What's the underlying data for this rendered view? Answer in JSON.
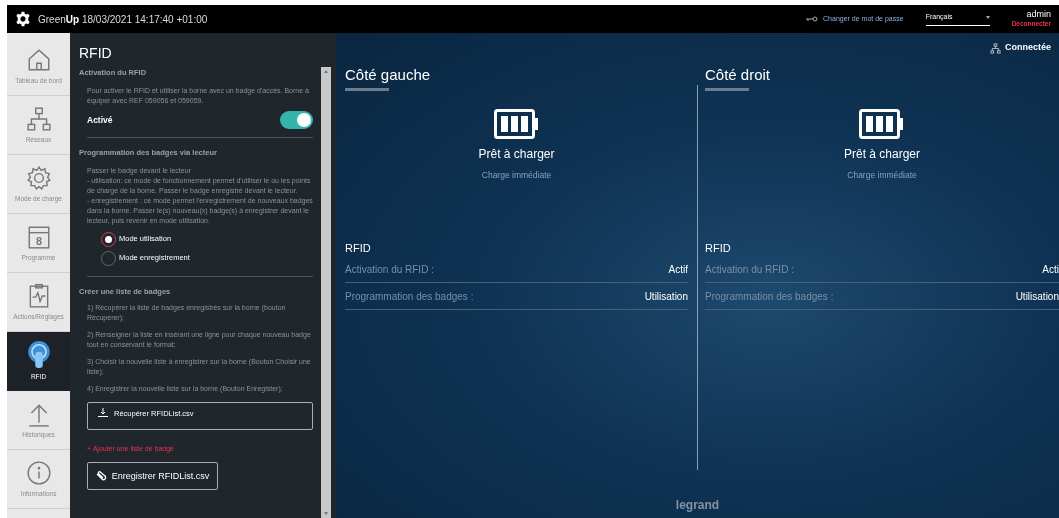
{
  "header": {
    "brand_light": "Green",
    "brand_bold": "Up",
    "datetime": "18/03/2021 14:17:40 +01:00",
    "change_password": "Changer de mot de passe",
    "language": "Français",
    "user": "admin",
    "logout": "Déconnecter"
  },
  "sidebar": {
    "items": [
      {
        "kind": "home",
        "label": "Tableau de bord",
        "selected": false
      },
      {
        "kind": "network",
        "label": "Réseaux",
        "selected": false
      },
      {
        "kind": "gear",
        "label": "Mode de charge",
        "selected": false
      },
      {
        "kind": "calendar",
        "label": "Programme",
        "day": "8",
        "selected": false
      },
      {
        "kind": "clipboard",
        "label": "Actions/Réglages",
        "selected": false
      },
      {
        "kind": "rfid",
        "label": "RFID",
        "selected": true
      },
      {
        "kind": "upload",
        "label": "Historiques",
        "selected": false
      },
      {
        "kind": "info",
        "label": "Informations",
        "selected": false
      }
    ]
  },
  "panel": {
    "title": "RFID",
    "activation": {
      "heading": "Activation du RFID",
      "text": "Pour activer le RFID et utiliser la borne avec un badge d'accès. Borne à équiper avec REF 059056 et 059059.",
      "toggle_label": "Activé",
      "on": true
    },
    "programming": {
      "heading": "Programmation des badges via lecteur",
      "lines": [
        "Passer le badge devant le lecteur",
        "- utilisation: ce mode de fonctionnement permet d'utiliser le ou les points de charge de la borne. Passer le badge enregistré devant le lecteur.",
        "- enregistrement : ce mode permet l'enregistrement de nouveaux badges dans la borne. Passer le(s) nouveau(x) badge(s) à enregistrer devant le lecteur, puis revenir en mode utilisation."
      ],
      "modes": [
        {
          "label": "Mode utilisation",
          "selected": true
        },
        {
          "label": "Mode enregistrement",
          "selected": false
        }
      ]
    },
    "list": {
      "heading": "Créer une liste de badges",
      "steps": [
        "1) Récupérer la liste de badges enregistrés sur la borne (bouton Récupérer);",
        "2) Renseigner la liste en insérant une ligne pour chaque nouveau badge tout en conservant le format;",
        "3) Choisir la nouvelle liste à enregistrer sur la borne (Bouton Choisir une liste);",
        "4) Enregistrer la nouvelle liste sur la borne (Bouton Enregister);"
      ],
      "download_button": "Récupérer RFIDList.csv",
      "add_link": "+ Ajouter une liste de badge",
      "save_button": "Enregistrer RFIDList.csv"
    }
  },
  "status": "Connectée",
  "sides": [
    {
      "title": "Côté gauche",
      "state": "Prêt à charger",
      "mode": "Charge immédiate",
      "section": "RFID",
      "rows": [
        {
          "label": "Activation du RFID :",
          "value": "Actif"
        },
        {
          "label": "Programmation des badges :",
          "value": "Utilisation"
        }
      ]
    },
    {
      "title": "Côté droit",
      "state": "Prêt à charger",
      "mode": "Charge immédiate",
      "section": "RFID",
      "rows": [
        {
          "label": "Activation du RFID :",
          "value": "Acti"
        },
        {
          "label": "Programmation des badges :",
          "value": "Utilisation"
        }
      ]
    }
  ],
  "footer_logo": "legrand"
}
